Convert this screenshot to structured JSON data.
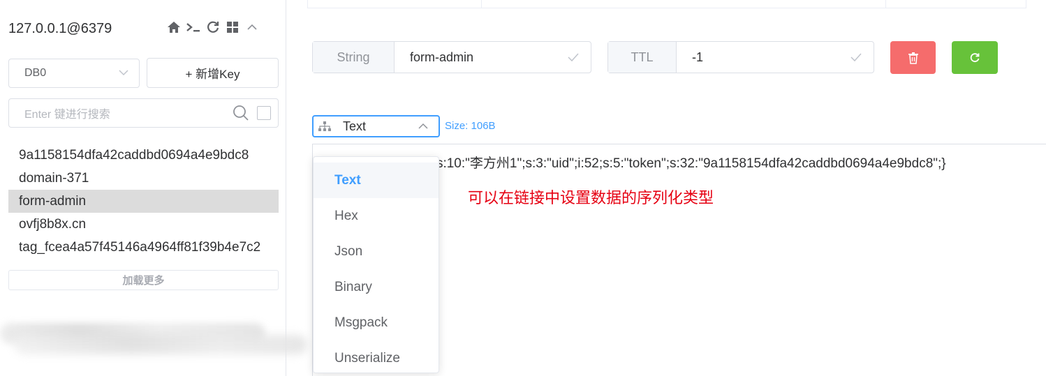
{
  "sidebar": {
    "server_title": "127.0.0.1@6379",
    "icons": [
      "home-icon",
      "terminal-icon",
      "refresh-icon",
      "grid-icon",
      "chevron-up-icon"
    ],
    "db_select": {
      "value": "DB0"
    },
    "add_key_label": "+ 新增Key",
    "search": {
      "placeholder": "Enter 键进行搜索"
    },
    "keys": [
      {
        "label": "9a1158154dfa42caddbd0694a4e9bdc8"
      },
      {
        "label": "domain-371"
      },
      {
        "label": "form-admin",
        "active": true
      },
      {
        "label": "ovfj8b8x.cn"
      },
      {
        "label": "tag_fcea4a57f45146a4964ff81f39b4e7c2"
      }
    ],
    "load_more_label": "加载更多"
  },
  "main": {
    "key_type": "String",
    "key_name": "form-admin",
    "ttl_label": "TTL",
    "ttl_value": "-1",
    "format": {
      "selected": "Text",
      "options": [
        "Text",
        "Hex",
        "Json",
        "Binary",
        "Msgpack",
        "Unserialize"
      ]
    },
    "size_label": "Size: 106B",
    "content_text": "a:4:{s:4:\"name\";s:10:\"李方州1\";s:3:\"uid\";i:52;s:5:\"token\";s:32:\"9a1158154dfa42caddbd0694a4e9bdc8\";}",
    "annotation": "可以在链接中设置数据的序列化类型"
  },
  "colors": {
    "accent": "#409eff",
    "danger": "#f56c6c",
    "success": "#67c23a",
    "annotation": "#e60012"
  }
}
